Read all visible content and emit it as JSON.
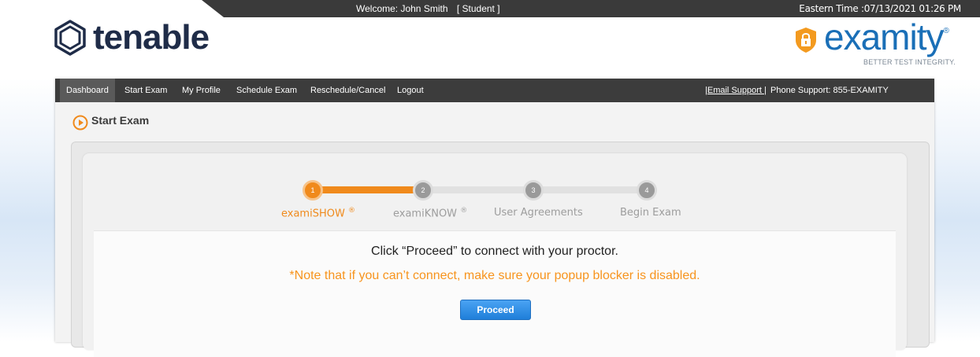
{
  "header": {
    "welcome": "Welcome: John Smith",
    "role": "[ Student ]",
    "eastern_time": "Eastern Time :07/13/2021 01:26 PM"
  },
  "logos": {
    "tenable": "tenable",
    "examity": "examity",
    "examity_registered": "®",
    "examity_tagline": "BETTER TEST INTEGRITY."
  },
  "nav": {
    "items": [
      {
        "label": "Dashboard"
      },
      {
        "label": "Start Exam"
      },
      {
        "label": "My Profile"
      },
      {
        "label": "Schedule Exam"
      },
      {
        "label": "Reschedule/Cancel"
      },
      {
        "label": "Logout"
      }
    ],
    "email_support": "|Email Support |",
    "phone_support": "Phone Support: 855-EXAMITY"
  },
  "page": {
    "title": "Start Exam"
  },
  "steps": [
    {
      "number": "1",
      "label": "examiSHOW",
      "sup": "®",
      "active": true
    },
    {
      "number": "2",
      "label": "examiKNOW",
      "sup": "®",
      "active": false
    },
    {
      "number": "3",
      "label": "User Agreements",
      "sup": "",
      "active": false
    },
    {
      "number": "4",
      "label": "Begin Exam",
      "sup": "",
      "active": false
    }
  ],
  "content": {
    "instruction": "Click “Proceed” to connect with your proctor.",
    "note": "*Note that if you can’t connect, make sure your popup blocker is disabled.",
    "proceed_label": "Proceed"
  },
  "colors": {
    "accent_orange": "#f08a1c",
    "note_orange": "#f7941d",
    "nav_bg": "#3c3c3c",
    "button_blue": "#1f7fd9",
    "tenable_navy": "#1f2c48",
    "examity_blue": "#1a6fb7"
  }
}
